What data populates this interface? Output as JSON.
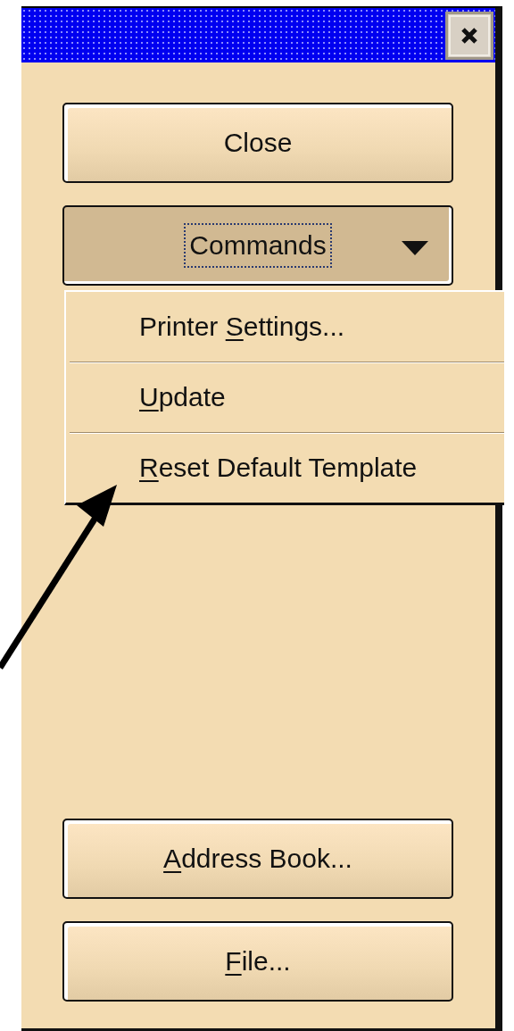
{
  "window": {
    "close_button": true
  },
  "buttons": [
    {
      "label": "Close",
      "kind": "push",
      "pressed": false,
      "focused": false
    },
    {
      "label": "Commands",
      "kind": "dropdown",
      "pressed": true,
      "focused": true
    }
  ],
  "menu": {
    "items": [
      {
        "label_parts": [
          {
            "text": "Printer ",
            "underline": false
          },
          {
            "text": "S",
            "underline": true
          },
          {
            "text": "ettings...",
            "underline": false
          }
        ]
      },
      {
        "label_parts": [
          {
            "text": "U",
            "underline": true
          },
          {
            "text": "pdate",
            "underline": false
          }
        ]
      },
      {
        "label_parts": [
          {
            "text": "R",
            "underline": true
          },
          {
            "text": "eset Default Template",
            "underline": false
          }
        ]
      }
    ]
  },
  "bottom_buttons": [
    {
      "label_parts": [
        {
          "text": "A",
          "underline": true
        },
        {
          "text": "ddress Book...",
          "underline": false
        }
      ]
    },
    {
      "label_parts": [
        {
          "text": "F",
          "underline": true
        },
        {
          "text": "ile...",
          "underline": false
        }
      ]
    }
  ],
  "annotation": {
    "kind": "arrow"
  }
}
